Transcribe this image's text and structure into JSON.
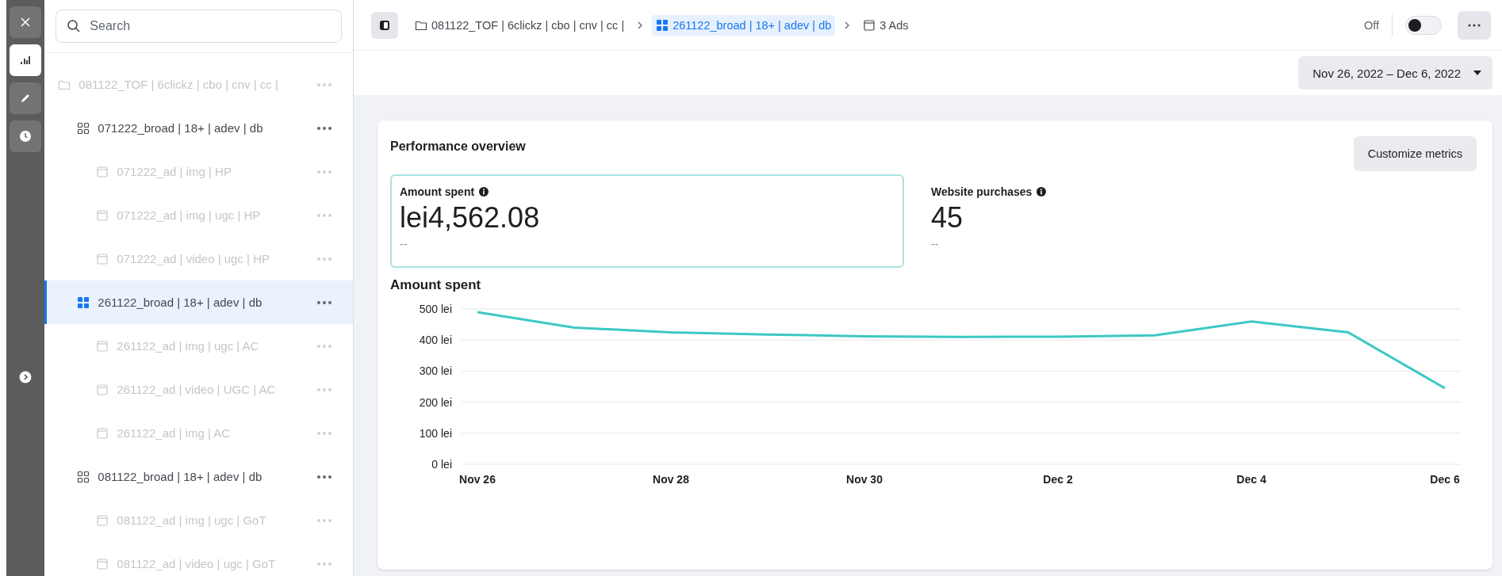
{
  "rail": {
    "items": [
      {
        "kind": "close",
        "selected": false
      },
      {
        "kind": "chart",
        "selected": true
      },
      {
        "kind": "edit",
        "selected": false
      },
      {
        "kind": "clock",
        "selected": false
      }
    ]
  },
  "sidebar": {
    "search": {
      "placeholder": "Search"
    },
    "tree": [
      {
        "label": "081122_TOF | 6clickz | cbo | cnv | cc |",
        "kind": "campaign",
        "disabled": true,
        "selected": false,
        "children": [
          {
            "label": "071222_broad | 18+ | adev | db",
            "kind": "adset",
            "disabled": false,
            "selected": false,
            "children": [
              {
                "label": "071222_ad | img | HP",
                "kind": "ad",
                "disabled": true,
                "selected": false
              },
              {
                "label": "071222_ad | img | ugc | HP",
                "kind": "ad",
                "disabled": true,
                "selected": false
              },
              {
                "label": "071222_ad | video | ugc | HP",
                "kind": "ad",
                "disabled": true,
                "selected": false
              }
            ]
          },
          {
            "label": "261122_broad | 18+ | adev | db",
            "kind": "adset",
            "disabled": false,
            "selected": true,
            "children": [
              {
                "label": "261122_ad | img | ugc | AC",
                "kind": "ad",
                "disabled": true,
                "selected": false
              },
              {
                "label": "261122_ad | video | UGC | AC",
                "kind": "ad",
                "disabled": true,
                "selected": false
              },
              {
                "label": "261122_ad | img | AC",
                "kind": "ad",
                "disabled": true,
                "selected": false
              }
            ]
          },
          {
            "label": "081122_broad | 18+ | adev | db",
            "kind": "adset",
            "disabled": false,
            "selected": false,
            "children": [
              {
                "label": "081122_ad | img | ugc | GoT",
                "kind": "ad",
                "disabled": true,
                "selected": false
              },
              {
                "label": "081122_ad | video | ugc | GoT",
                "kind": "ad",
                "disabled": true,
                "selected": false
              }
            ]
          }
        ]
      }
    ]
  },
  "breadcrumbs": [
    {
      "label": "081122_TOF | 6clickz | cbo | cnv | cc |",
      "kind": "campaign",
      "selected": false
    },
    {
      "label": "261122_broad | 18+ | adev | db",
      "kind": "adset",
      "selected": true
    },
    {
      "label": "3 Ads",
      "kind": "ad",
      "selected": false
    }
  ],
  "toggle": {
    "label": "Off",
    "on": false
  },
  "date_range": "Nov 26, 2022 – Dec 6, 2022",
  "overview": {
    "title": "Performance overview",
    "customize_button": "Customize metrics",
    "metrics": [
      {
        "label": "Amount spent",
        "value": "lei4,562.08",
        "comparison": "--",
        "selected": true
      },
      {
        "label": "Website purchases",
        "value": "45",
        "comparison": "--",
        "selected": false
      }
    ],
    "chart_data": {
      "type": "line",
      "title": "Amount spent",
      "grid": true,
      "categories": [
        "Nov 26",
        null,
        "Nov 28",
        null,
        "Nov 30",
        null,
        "Dec 2",
        null,
        "Dec 4",
        null,
        "Dec 6"
      ],
      "series": [
        {
          "color": "#3cc8c4",
          "values": [
            490,
            440,
            425,
            418,
            412,
            410,
            411,
            415,
            460,
            425,
            245
          ]
        }
      ],
      "ylim": [
        0,
        500
      ],
      "yticks": [
        {
          "value": 0,
          "label": "0 lei"
        },
        {
          "value": 100,
          "label": "100 lei"
        },
        {
          "value": 200,
          "label": "200 lei"
        },
        {
          "value": 300,
          "label": "300 lei"
        },
        {
          "value": 400,
          "label": "400 lei"
        },
        {
          "value": 500,
          "label": "500 lei"
        }
      ]
    }
  }
}
